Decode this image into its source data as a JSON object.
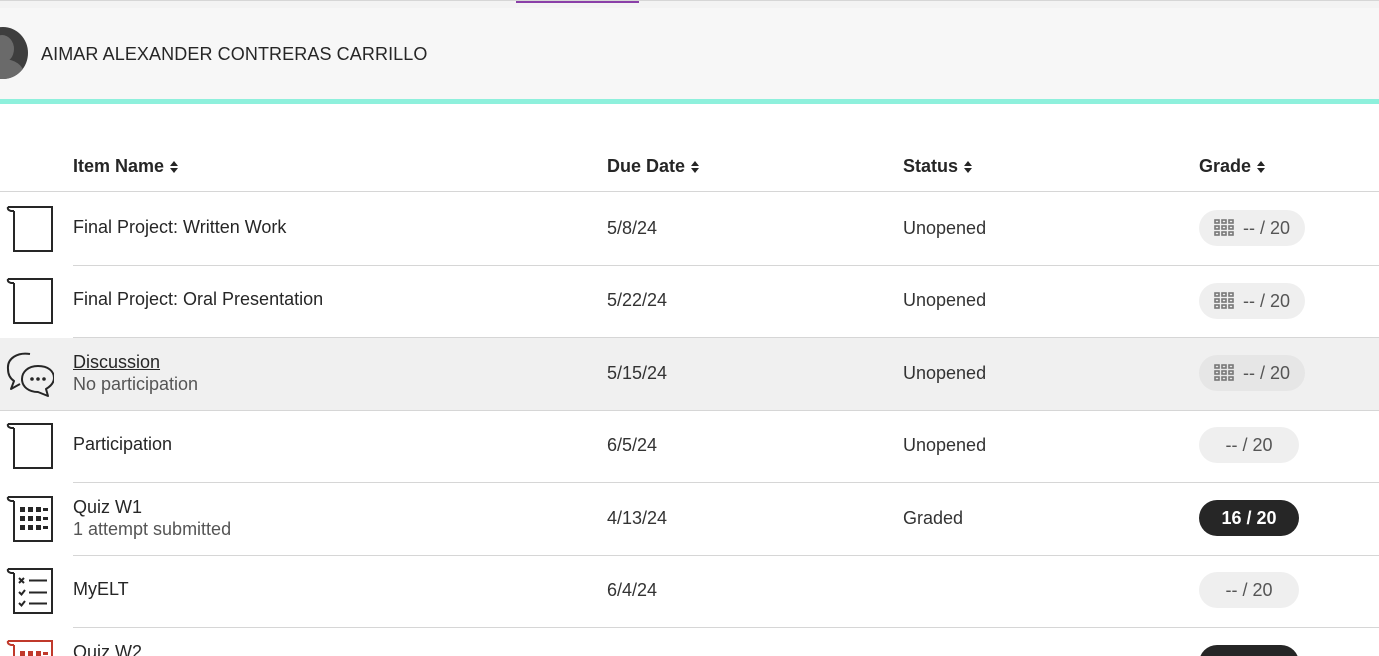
{
  "user": {
    "name": "AIMAR ALEXANDER CONTRERAS CARRILLO"
  },
  "colors": {
    "accent": "#8ef0dc",
    "tab_active": "#8a3fa8",
    "graded_pill": "#262626",
    "pill": "#efefef",
    "quiz_icon_red": "#c0392b"
  },
  "columns": {
    "item_name": "Item Name",
    "due_date": "Due Date",
    "status": "Status",
    "grade": "Grade"
  },
  "rows": [
    {
      "icon": "document-icon",
      "title": "Final Project: Written Work",
      "subtitle": "",
      "due": "5/8/24",
      "status": "Unopened",
      "grade": "-- / 20",
      "rubric": true,
      "graded": false
    },
    {
      "icon": "document-icon",
      "title": "Final Project: Oral Presentation",
      "subtitle": "",
      "due": "5/22/24",
      "status": "Unopened",
      "grade": "-- / 20",
      "rubric": true,
      "graded": false
    },
    {
      "icon": "discussion-icon",
      "title": "Discussion",
      "subtitle": "No participation",
      "due": "5/15/24",
      "status": "Unopened",
      "grade": "-- / 20",
      "rubric": true,
      "graded": false
    },
    {
      "icon": "document-icon",
      "title": "Participation",
      "subtitle": "",
      "due": "6/5/24",
      "status": "Unopened",
      "grade": "-- / 20",
      "rubric": false,
      "graded": false
    },
    {
      "icon": "test-icon",
      "title": "Quiz W1",
      "subtitle": "1 attempt submitted",
      "due": "4/13/24",
      "status": "Graded",
      "grade": "16 / 20",
      "rubric": false,
      "graded": true
    },
    {
      "icon": "checklist-icon",
      "title": "MyELT",
      "subtitle": "",
      "due": "6/4/24",
      "status": "",
      "grade": "-- / 20",
      "rubric": false,
      "graded": false
    },
    {
      "icon": "test-icon",
      "title": "Quiz W2",
      "subtitle": "",
      "due": "",
      "status": "",
      "grade": "",
      "rubric": false,
      "graded": true
    }
  ]
}
